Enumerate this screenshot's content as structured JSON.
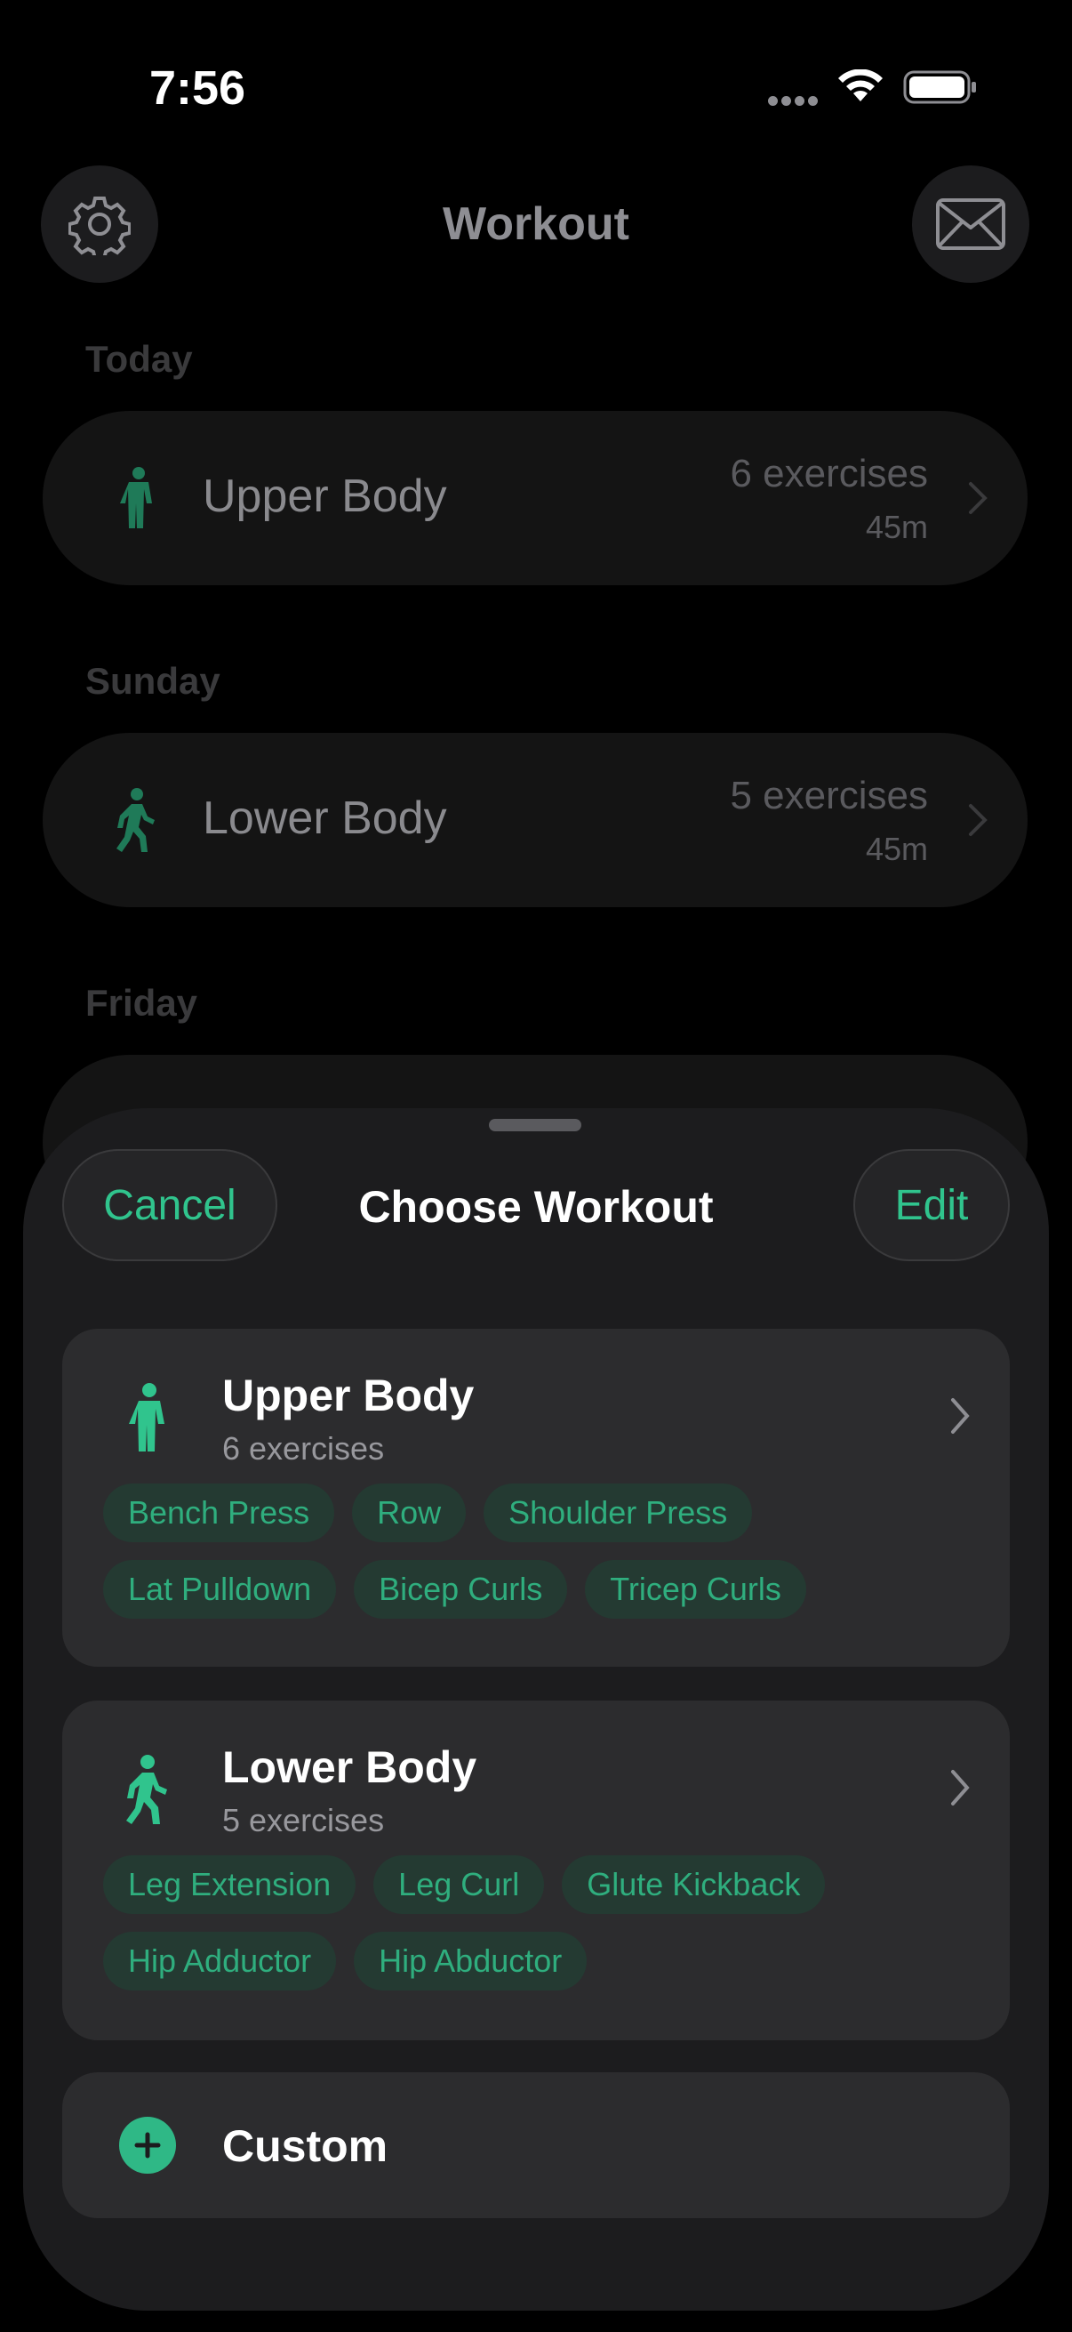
{
  "status_bar": {
    "time": "7:56"
  },
  "header": {
    "title": "Workout"
  },
  "schedule": [
    {
      "day": "Today",
      "name": "Upper Body",
      "exercises": "6 exercises",
      "duration": "45m",
      "icon": "standing-figure-icon"
    },
    {
      "day": "Sunday",
      "name": "Lower Body",
      "exercises": "5 exercises",
      "duration": "45m",
      "icon": "walking-figure-icon"
    },
    {
      "day": "Friday"
    }
  ],
  "sheet": {
    "title": "Choose Workout",
    "cancel_label": "Cancel",
    "edit_label": "Edit",
    "workouts": [
      {
        "name": "Upper Body",
        "count": "6 exercises",
        "icon": "standing-figure-icon",
        "tags": [
          "Bench Press",
          "Row",
          "Shoulder Press",
          "Lat Pulldown",
          "Bicep Curls",
          "Tricep Curls"
        ]
      },
      {
        "name": "Lower Body",
        "count": "5 exercises",
        "icon": "walking-figure-icon",
        "tags": [
          "Leg Extension",
          "Leg Curl",
          "Glute Kickback",
          "Hip Adductor",
          "Hip Abductor"
        ]
      }
    ],
    "custom_label": "Custom"
  },
  "colors": {
    "accent": "#30c48d",
    "sheet_bg": "#1c1c1e",
    "card_bg": "#2c2c2e",
    "tag_bg": "#243a32"
  }
}
